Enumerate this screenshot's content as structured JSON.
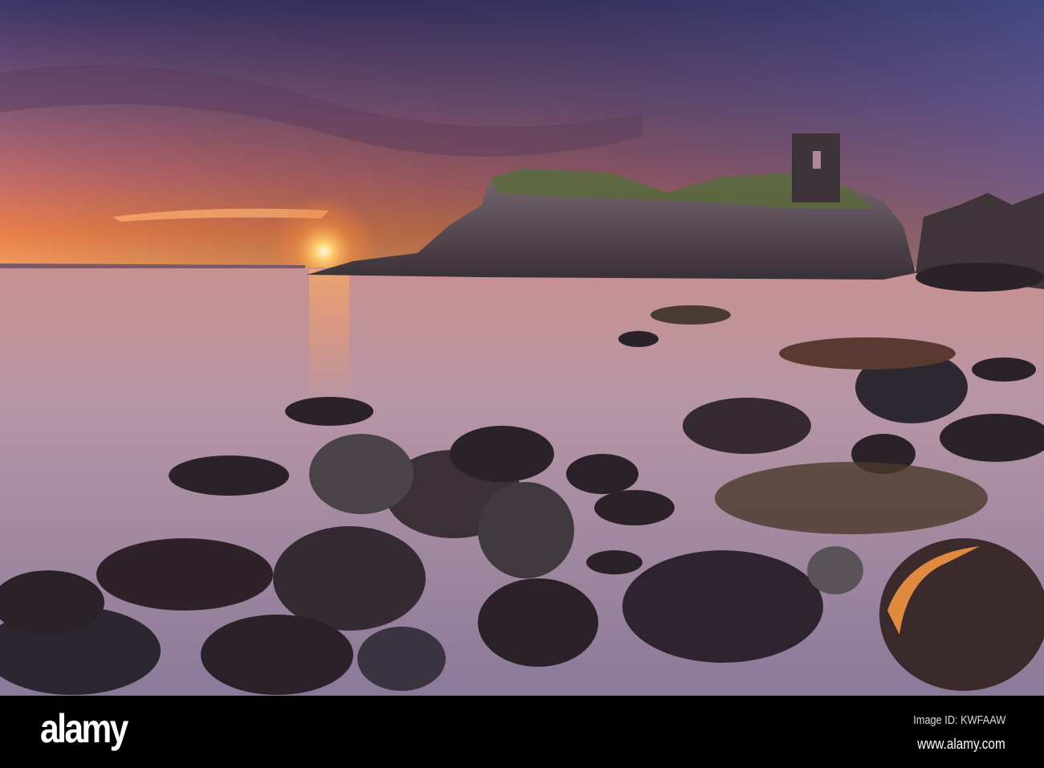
{
  "scene": {
    "subject": "sunset over rocky coast with castle ruin",
    "colors": {
      "sky_top": "#3b3a6e",
      "sky_mid": "#9a5a7a",
      "horizon": "#f08040",
      "sun": "#fff2b0",
      "water": "#b898a8",
      "rock": "#2a2228"
    }
  },
  "watermark": {
    "overlay_text": "alamy"
  },
  "footer": {
    "logo": "alamy",
    "image_id": "Image ID: KWFAAW",
    "website": "www.alamy.com"
  }
}
